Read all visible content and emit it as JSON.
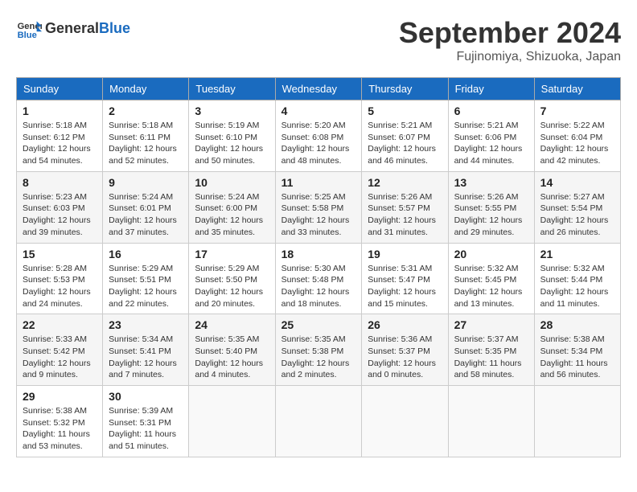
{
  "header": {
    "logo_general": "General",
    "logo_blue": "Blue",
    "month_title": "September 2024",
    "subtitle": "Fujinomiya, Shizuoka, Japan"
  },
  "days_of_week": [
    "Sunday",
    "Monday",
    "Tuesday",
    "Wednesday",
    "Thursday",
    "Friday",
    "Saturday"
  ],
  "weeks": [
    [
      {
        "day": "1",
        "sunrise": "5:18 AM",
        "sunset": "6:12 PM",
        "daylight": "12 hours and 54 minutes."
      },
      {
        "day": "2",
        "sunrise": "5:18 AM",
        "sunset": "6:11 PM",
        "daylight": "12 hours and 52 minutes."
      },
      {
        "day": "3",
        "sunrise": "5:19 AM",
        "sunset": "6:10 PM",
        "daylight": "12 hours and 50 minutes."
      },
      {
        "day": "4",
        "sunrise": "5:20 AM",
        "sunset": "6:08 PM",
        "daylight": "12 hours and 48 minutes."
      },
      {
        "day": "5",
        "sunrise": "5:21 AM",
        "sunset": "6:07 PM",
        "daylight": "12 hours and 46 minutes."
      },
      {
        "day": "6",
        "sunrise": "5:21 AM",
        "sunset": "6:06 PM",
        "daylight": "12 hours and 44 minutes."
      },
      {
        "day": "7",
        "sunrise": "5:22 AM",
        "sunset": "6:04 PM",
        "daylight": "12 hours and 42 minutes."
      }
    ],
    [
      {
        "day": "8",
        "sunrise": "5:23 AM",
        "sunset": "6:03 PM",
        "daylight": "12 hours and 39 minutes."
      },
      {
        "day": "9",
        "sunrise": "5:24 AM",
        "sunset": "6:01 PM",
        "daylight": "12 hours and 37 minutes."
      },
      {
        "day": "10",
        "sunrise": "5:24 AM",
        "sunset": "6:00 PM",
        "daylight": "12 hours and 35 minutes."
      },
      {
        "day": "11",
        "sunrise": "5:25 AM",
        "sunset": "5:58 PM",
        "daylight": "12 hours and 33 minutes."
      },
      {
        "day": "12",
        "sunrise": "5:26 AM",
        "sunset": "5:57 PM",
        "daylight": "12 hours and 31 minutes."
      },
      {
        "day": "13",
        "sunrise": "5:26 AM",
        "sunset": "5:55 PM",
        "daylight": "12 hours and 29 minutes."
      },
      {
        "day": "14",
        "sunrise": "5:27 AM",
        "sunset": "5:54 PM",
        "daylight": "12 hours and 26 minutes."
      }
    ],
    [
      {
        "day": "15",
        "sunrise": "5:28 AM",
        "sunset": "5:53 PM",
        "daylight": "12 hours and 24 minutes."
      },
      {
        "day": "16",
        "sunrise": "5:29 AM",
        "sunset": "5:51 PM",
        "daylight": "12 hours and 22 minutes."
      },
      {
        "day": "17",
        "sunrise": "5:29 AM",
        "sunset": "5:50 PM",
        "daylight": "12 hours and 20 minutes."
      },
      {
        "day": "18",
        "sunrise": "5:30 AM",
        "sunset": "5:48 PM",
        "daylight": "12 hours and 18 minutes."
      },
      {
        "day": "19",
        "sunrise": "5:31 AM",
        "sunset": "5:47 PM",
        "daylight": "12 hours and 15 minutes."
      },
      {
        "day": "20",
        "sunrise": "5:32 AM",
        "sunset": "5:45 PM",
        "daylight": "12 hours and 13 minutes."
      },
      {
        "day": "21",
        "sunrise": "5:32 AM",
        "sunset": "5:44 PM",
        "daylight": "12 hours and 11 minutes."
      }
    ],
    [
      {
        "day": "22",
        "sunrise": "5:33 AM",
        "sunset": "5:42 PM",
        "daylight": "12 hours and 9 minutes."
      },
      {
        "day": "23",
        "sunrise": "5:34 AM",
        "sunset": "5:41 PM",
        "daylight": "12 hours and 7 minutes."
      },
      {
        "day": "24",
        "sunrise": "5:35 AM",
        "sunset": "5:40 PM",
        "daylight": "12 hours and 4 minutes."
      },
      {
        "day": "25",
        "sunrise": "5:35 AM",
        "sunset": "5:38 PM",
        "daylight": "12 hours and 2 minutes."
      },
      {
        "day": "26",
        "sunrise": "5:36 AM",
        "sunset": "5:37 PM",
        "daylight": "12 hours and 0 minutes."
      },
      {
        "day": "27",
        "sunrise": "5:37 AM",
        "sunset": "5:35 PM",
        "daylight": "11 hours and 58 minutes."
      },
      {
        "day": "28",
        "sunrise": "5:38 AM",
        "sunset": "5:34 PM",
        "daylight": "11 hours and 56 minutes."
      }
    ],
    [
      {
        "day": "29",
        "sunrise": "5:38 AM",
        "sunset": "5:32 PM",
        "daylight": "11 hours and 53 minutes."
      },
      {
        "day": "30",
        "sunrise": "5:39 AM",
        "sunset": "5:31 PM",
        "daylight": "11 hours and 51 minutes."
      },
      null,
      null,
      null,
      null,
      null
    ]
  ]
}
